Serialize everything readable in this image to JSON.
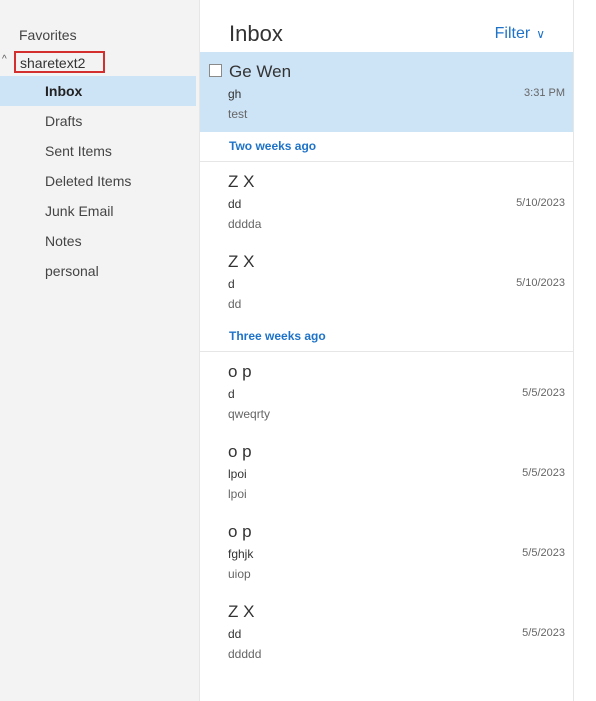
{
  "sidebar": {
    "favorites_label": "Favorites",
    "account_label": "sharetext2",
    "folders": [
      {
        "label": "Inbox",
        "selected": true
      },
      {
        "label": "Drafts"
      },
      {
        "label": "Sent Items"
      },
      {
        "label": "Deleted Items"
      },
      {
        "label": "Junk Email"
      },
      {
        "label": "Notes"
      },
      {
        "label": "personal"
      }
    ]
  },
  "main": {
    "title": "Inbox",
    "filter_label": "Filter",
    "selected_message": {
      "sender": "Ge Wen",
      "subject": "gh",
      "preview": "test",
      "time": "3:31 PM"
    },
    "groups": [
      {
        "label": "Two weeks ago"
      },
      {
        "label": "Three weeks ago"
      }
    ],
    "messages": [
      {
        "sender": "Z X",
        "subject": "dd",
        "preview": "dddda",
        "time": "5/10/2023"
      },
      {
        "sender": "Z X",
        "subject": "d",
        "preview": "dd",
        "time": "5/10/2023"
      },
      {
        "sender": "o p",
        "subject": "d",
        "preview": "qweqrty",
        "time": "5/5/2023"
      },
      {
        "sender": "o p",
        "subject": "lpoi",
        "preview": "lpoi",
        "time": "5/5/2023"
      },
      {
        "sender": "o p",
        "subject": "fghjk",
        "preview": "uiop",
        "time": "5/5/2023"
      },
      {
        "sender": "Z X",
        "subject": "dd",
        "preview": "ddddd",
        "time": "5/5/2023"
      }
    ]
  },
  "colors": {
    "accent": "#1e73c8",
    "selected_bg": "#cde3f6",
    "sidebar_bg": "#f3f3f3",
    "highlight_box": "#d32f2f"
  },
  "icons": {
    "collapse": "chevron-up-icon",
    "filter": "chevron-down-icon"
  }
}
